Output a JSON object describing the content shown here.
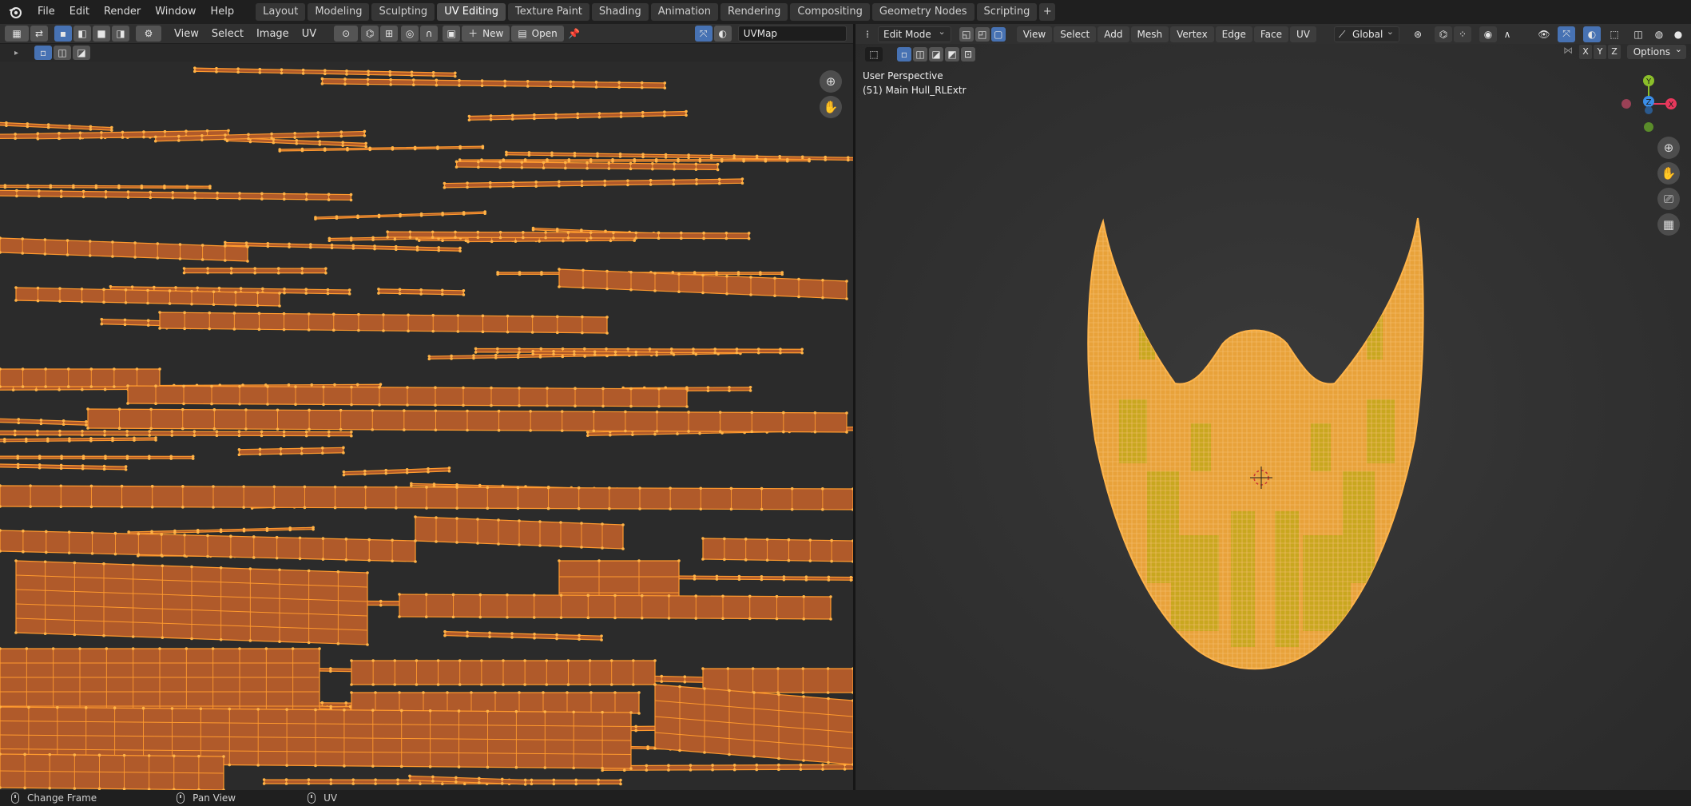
{
  "app": {
    "name": "Blender"
  },
  "menu": [
    "File",
    "Edit",
    "Render",
    "Window",
    "Help"
  ],
  "workspace_tabs": [
    {
      "label": "Layout",
      "active": false
    },
    {
      "label": "Modeling",
      "active": false
    },
    {
      "label": "Sculpting",
      "active": false
    },
    {
      "label": "UV Editing",
      "active": true
    },
    {
      "label": "Texture Paint",
      "active": false
    },
    {
      "label": "Shading",
      "active": false
    },
    {
      "label": "Animation",
      "active": false
    },
    {
      "label": "Rendering",
      "active": false
    },
    {
      "label": "Compositing",
      "active": false
    },
    {
      "label": "Geometry Nodes",
      "active": false
    },
    {
      "label": "Scripting",
      "active": false
    }
  ],
  "add_tab_label": "+",
  "uv_editor": {
    "menus": [
      "View",
      "Select",
      "Image",
      "UV"
    ],
    "new_label": "New",
    "open_label": "Open",
    "uv_map": "UVMap"
  },
  "viewport": {
    "mode": "Edit Mode",
    "menus": [
      "View",
      "Select",
      "Add",
      "Mesh",
      "Vertex",
      "Edge",
      "Face",
      "UV"
    ],
    "orientation": "Global",
    "perspective": "User Perspective",
    "object": "(51) Main Hull_RLExtr",
    "axes": [
      "X",
      "Y",
      "Z"
    ],
    "options_label": "Options",
    "gizmo_labels": {
      "y": "Y",
      "z": "Z",
      "x": "X"
    }
  },
  "statusbar": [
    {
      "label": "Change Frame",
      "icon": "mouse-left-icon"
    },
    {
      "label": "Pan View",
      "icon": "mouse-middle-icon"
    },
    {
      "label": "UV",
      "icon": "mouse-right-icon"
    }
  ],
  "colors": {
    "uv_fill": "#b05a2a",
    "uv_edge": "#ff9a2e",
    "mesh_fill": "#e8a23a",
    "mesh_panel": "#c9a71f",
    "active_blue": "#4772b3",
    "axis_x": "#e8385c",
    "axis_y": "#8bbf2a",
    "axis_z": "#3b8ee8"
  }
}
